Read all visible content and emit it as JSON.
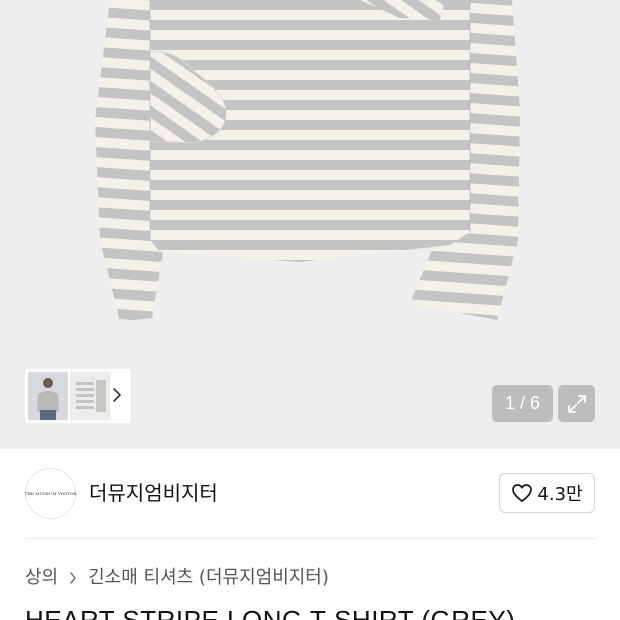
{
  "gallery": {
    "pager": "1 / 6",
    "thumbnail_count": 2
  },
  "brand": {
    "logo_text": "THE MUSEUM VISITOR",
    "name": "더뮤지엄비지터"
  },
  "like": {
    "count": "4.3만"
  },
  "breadcrumb": {
    "items": [
      "상의",
      "긴소매 티셔츠 (더뮤지엄비지터)"
    ]
  },
  "product": {
    "title": "HEART STRIPE LONG T-SHIRT (GREY)"
  },
  "colors": {
    "gallery_bg": "#eeeeee",
    "stripe_grey": "#c4c4c2",
    "stripe_cream": "#f3f1e8",
    "text": "#222222"
  },
  "icons": {
    "thumb_next": "chevron-right-icon",
    "expand": "expand-icon",
    "like": "heart-outline-icon",
    "breadcrumb_sep": "chevron-right-icon"
  }
}
